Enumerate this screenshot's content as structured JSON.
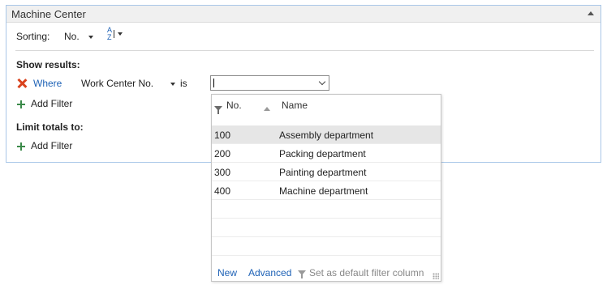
{
  "panel": {
    "title": "Machine Center"
  },
  "sorting": {
    "label": "Sorting:",
    "value": "No.",
    "az_top": "A",
    "az_bottom": "Z"
  },
  "show_results": {
    "heading": "Show results:",
    "where_label": "Where",
    "field": "Work Center No.",
    "operator": "is",
    "add_filter": "Add Filter"
  },
  "limit_totals": {
    "heading": "Limit totals to:",
    "add_filter": "Add Filter"
  },
  "value_input": {
    "value": ""
  },
  "lookup": {
    "columns": [
      "No.",
      "Name"
    ],
    "rows": [
      {
        "no": "100",
        "name": "Assembly department",
        "selected": true
      },
      {
        "no": "200",
        "name": "Packing department"
      },
      {
        "no": "300",
        "name": "Painting department"
      },
      {
        "no": "400",
        "name": "Machine department"
      }
    ],
    "footer": {
      "new": "New",
      "advanced": "Advanced",
      "set_default": "Set as default filter column"
    }
  },
  "colors": {
    "accent": "#1e62b6",
    "remove": "#d9431e",
    "add": "#3b8a4a",
    "selected_row": "#e6e6e6",
    "panel_border": "#a9c7e8"
  }
}
